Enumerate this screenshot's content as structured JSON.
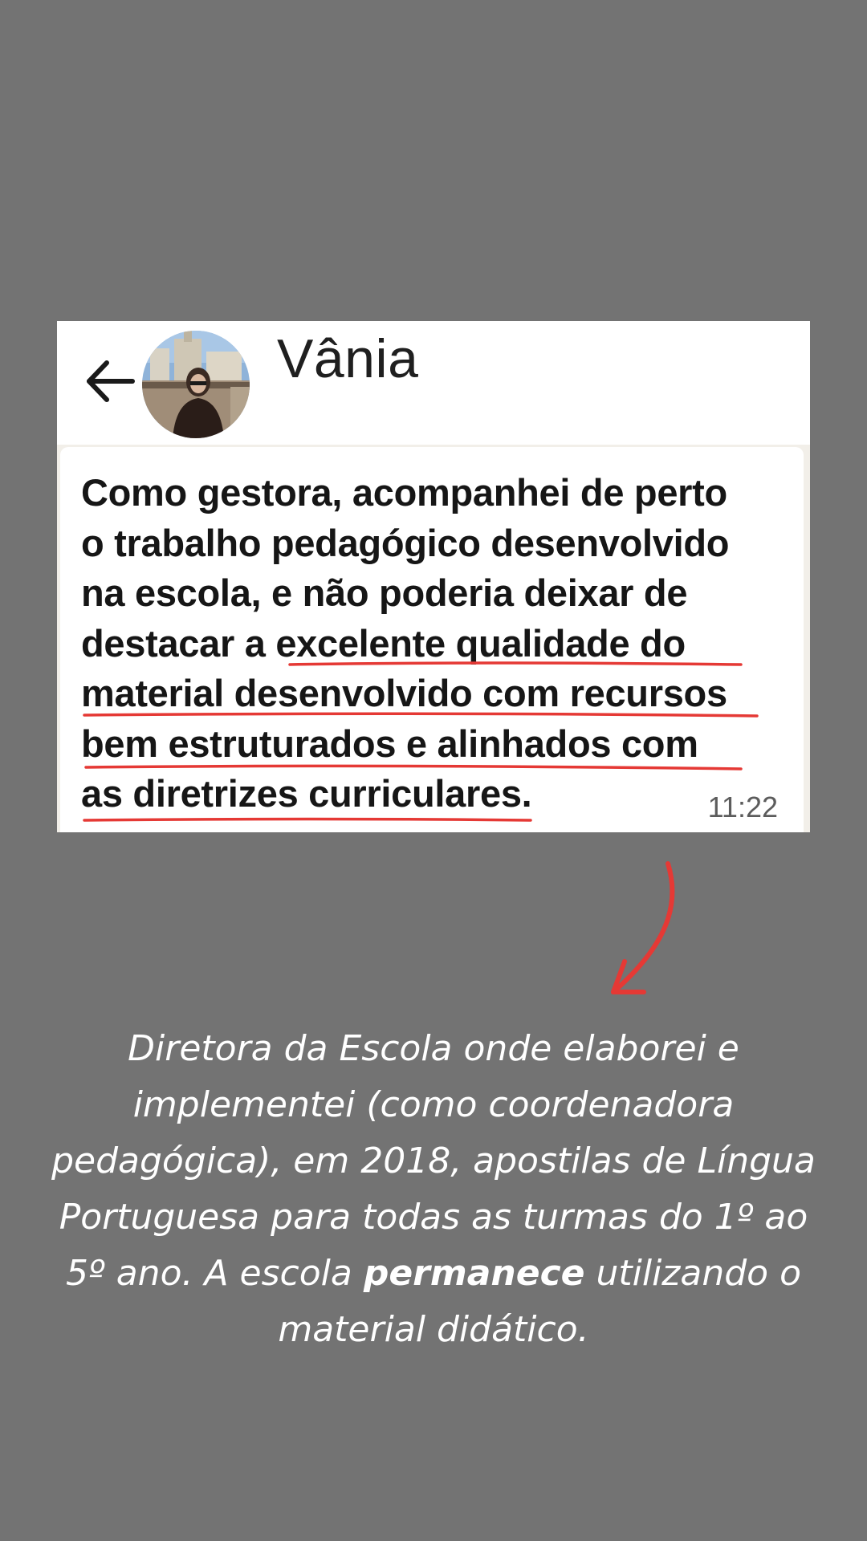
{
  "chat": {
    "contact_name": "Vânia",
    "message_line_1": "Como gestora, acompanhei de perto",
    "message_line_2": "o trabalho pedagógico desenvolvido",
    "message_line_3": "na escola, e não poderia deixar de",
    "message_line_4_plain": "destacar a ",
    "message_line_4_highlight": "excelente qualidade do",
    "message_line_5": "material desenvolvido com recursos",
    "message_line_6": "bem estruturados e alinhados com",
    "message_line_7": "as diretrizes curriculares.",
    "timestamp": "11:22"
  },
  "caption": {
    "part_1": "Diretora da Escola onde elaborei e implementei (como coordenadora pedagógica), em 2018, apostilas de Língua Portuguesa para todas as turmas do 1º ao 5º ano. A escola ",
    "bold": "permanece",
    "part_2": " utilizando o material didático."
  },
  "icons": {
    "back": "arrow-left-icon",
    "annotation": "curved-arrow-icon"
  },
  "colors": {
    "background": "#737373",
    "underline": "#e53935",
    "arrow": "#e53935",
    "caption_text": "#ffffff"
  }
}
